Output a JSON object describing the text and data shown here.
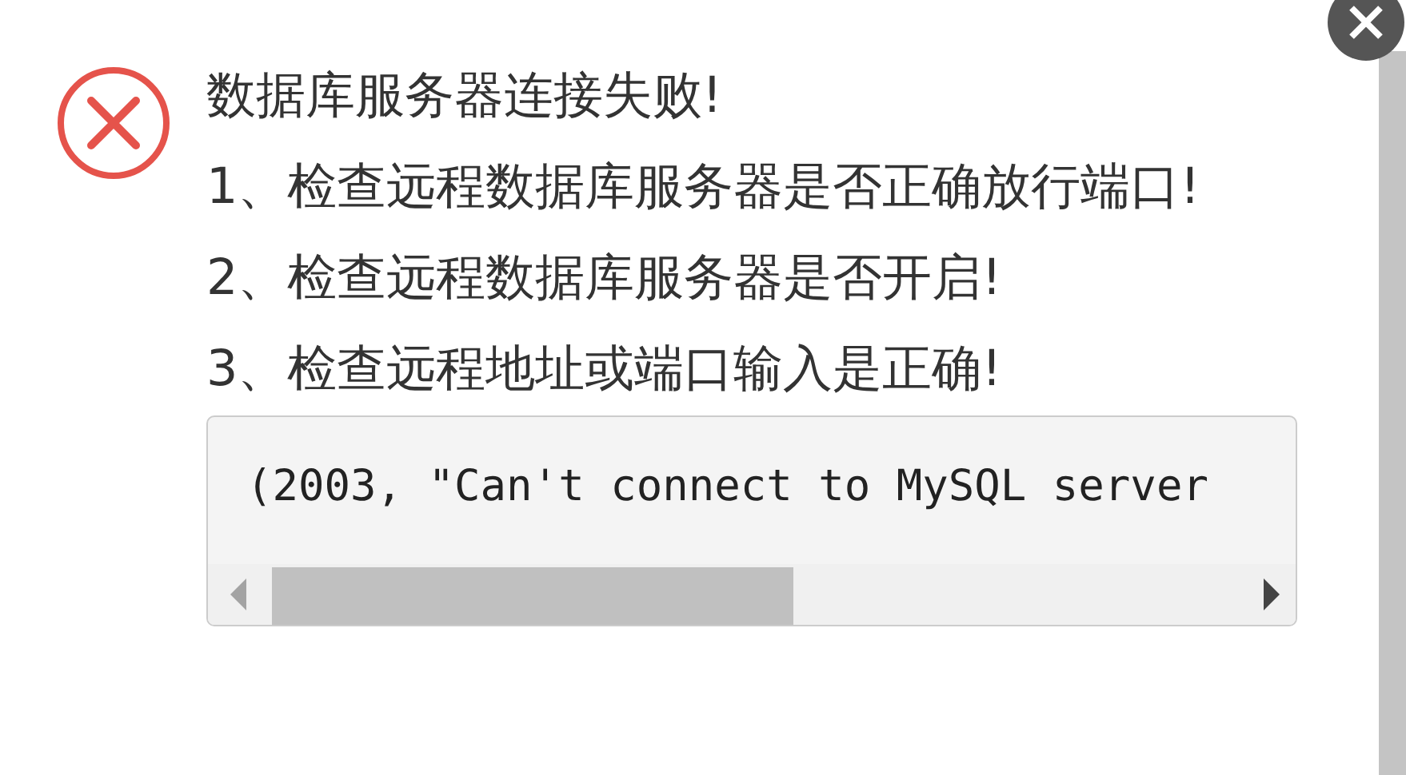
{
  "dialog": {
    "title": "数据库服务器连接失败!",
    "hints": [
      "1、检查远程数据库服务器是否正确放行端口!",
      "2、检查远程数据库服务器是否开启!",
      "3、检查远程地址或端口输入是正确!"
    ],
    "error_detail": "(2003, \"Can't connect to MySQL server"
  }
}
